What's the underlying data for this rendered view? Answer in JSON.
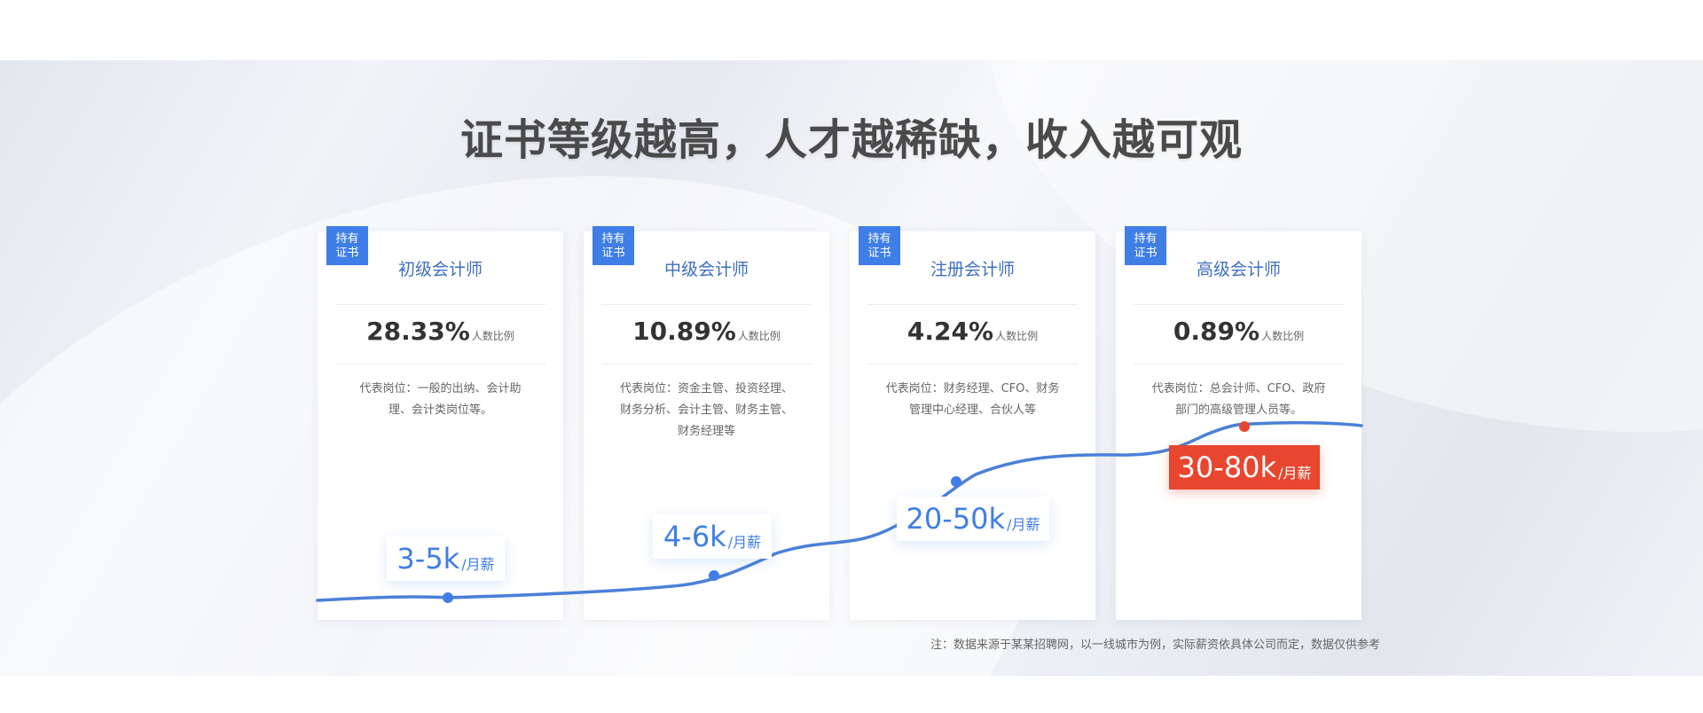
{
  "title": "证书等级越高，人才越稀缺，收入越可观",
  "badge_text": "持有\n证书",
  "cards": [
    {
      "name": "初级会计师",
      "percent": "28.33%",
      "percent_label": "人数比例",
      "description": "代表岗位：一般的出纳、会计助理、会计类岗位等。",
      "salary": "3-5k",
      "salary_unit": "/月薪"
    },
    {
      "name": "中级会计师",
      "percent": "10.89%",
      "percent_label": "人数比例",
      "description": "代表岗位：资金主管、投资经理、财务分析、会计主管、财务主管、财务经理等",
      "salary": "4-6k",
      "salary_unit": "/月薪"
    },
    {
      "name": "注册会计师",
      "percent": "4.24%",
      "percent_label": "人数比例",
      "description": "代表岗位：财务经理、CFO、财务管理中心经理、合伙人等",
      "salary": "20-50k",
      "salary_unit": "/月薪"
    },
    {
      "name": "高级会计师",
      "percent": "0.89%",
      "percent_label": "人数比例",
      "description": "代表岗位：总会计师、CFO、政府部门的高级管理人员等。",
      "salary": "30-80k",
      "salary_unit": "/月薪"
    }
  ],
  "note": "注：数据来源于某某招聘网，以一线城市为例，实际薪资依具体公司而定，数据仅供参考",
  "colors": {
    "accent_blue": "#3f7ee6",
    "curve_blue": "#4a80d8",
    "highlight_red": "#e8462e",
    "title_gray": "#4a4a4a"
  }
}
